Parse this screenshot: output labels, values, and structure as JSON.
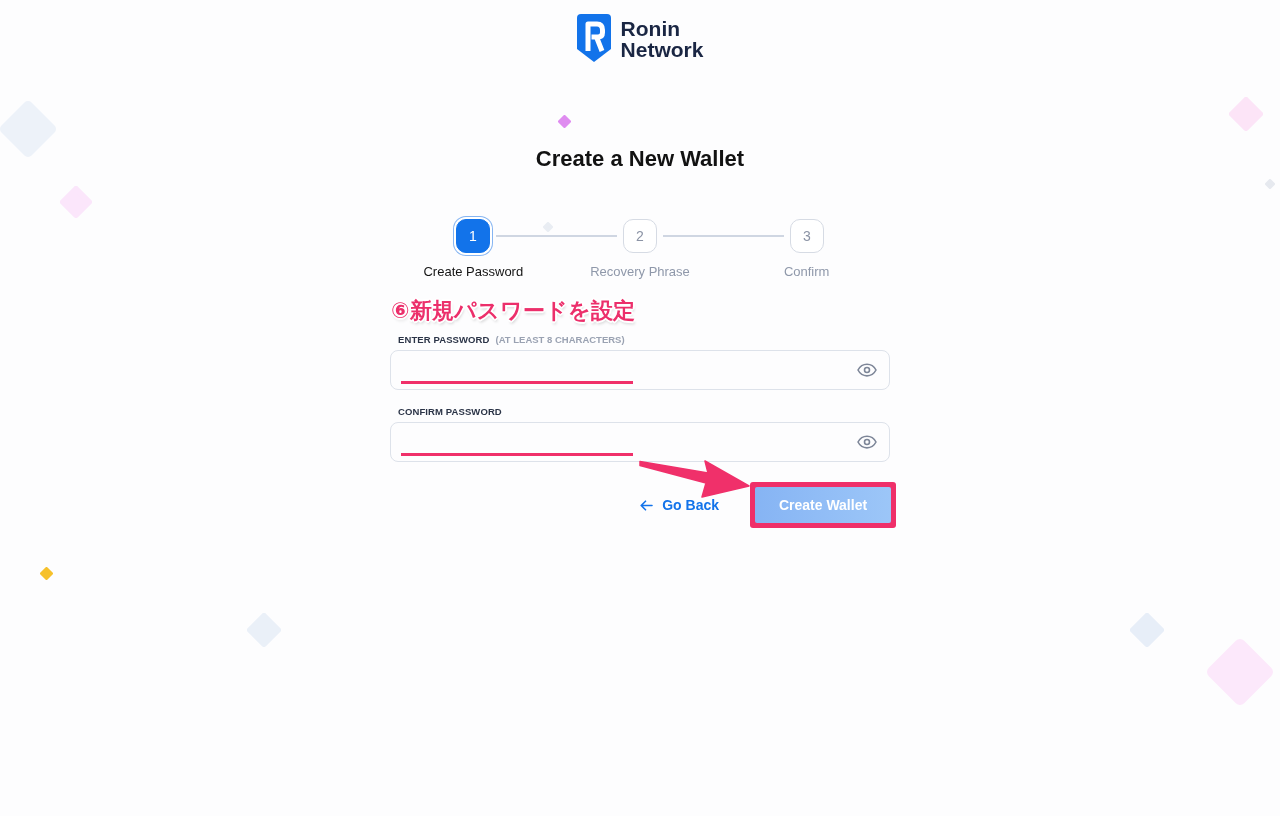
{
  "logo": {
    "lines": [
      "Ronin",
      "Network"
    ]
  },
  "title": "Create a New Wallet",
  "steps": [
    {
      "number": "1",
      "label": "Create Password",
      "selected": true
    },
    {
      "number": "2",
      "label": "Recovery Phrase",
      "selected": false
    },
    {
      "number": "3",
      "label": "Confirm",
      "selected": false
    }
  ],
  "annotation": {
    "text": "⑥新規パスワードを設定"
  },
  "fields": [
    {
      "label": "ENTER PASSWORD",
      "hint": "(AT LEAST 8 CHARACTERS)",
      "underlined": true
    },
    {
      "label": "CONFIRM PASSWORD",
      "underlined": true
    }
  ],
  "actions": {
    "back_link": {
      "label": "Go Back"
    },
    "submit": {
      "label": "Create Wallet",
      "disabled": true,
      "highlighted": true
    }
  }
}
